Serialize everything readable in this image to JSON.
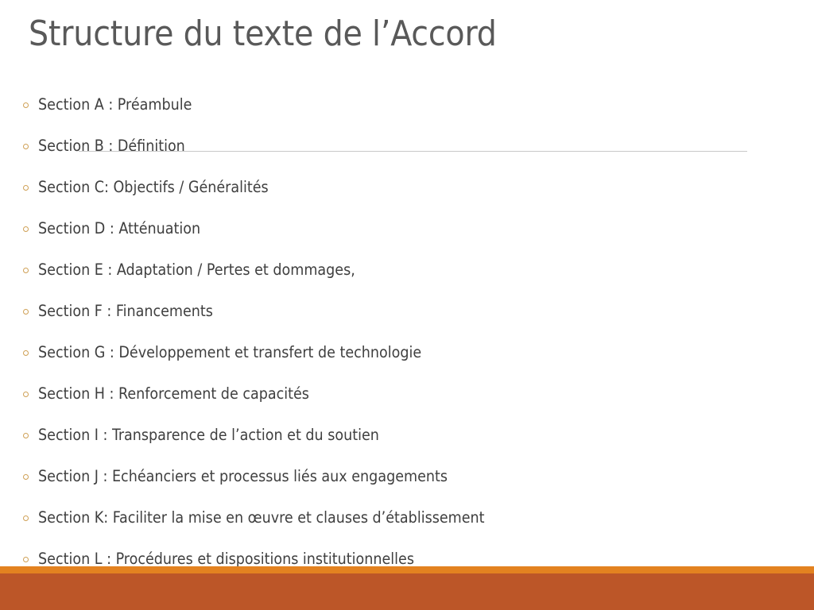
{
  "slide": {
    "title": "Structure du texte de l’Accord",
    "title_color": "#595959",
    "background_color": "#ffffff",
    "bullet_glyph": "◦",
    "bullet_color": "#CFA055",
    "body_text_color": "#3f3f3f",
    "divider_color": "#c9c9c9",
    "items": [
      {
        "label": "Section A : Préambule"
      },
      {
        "label": "Section B : Définition"
      },
      {
        "label": "Section C: Objectifs / Généralités"
      },
      {
        "label": "Section D : Atténuation"
      },
      {
        "label": "Section E : Adaptation / Pertes et dommages,"
      },
      {
        "label": "Section F : Financements"
      },
      {
        "label": "Section G : Développement et transfert de technologie"
      },
      {
        "label": "Section H : Renforcement de capacités"
      },
      {
        "label": "Section I : Transparence de l’action et du soutien"
      },
      {
        "label": "Section J : Echéanciers et processus liés aux engagements"
      },
      {
        "label": "Section K: Faciliter la mise en œuvre et clauses d’établissement"
      },
      {
        "label": "Section L : Procédures et dispositions institutionnelles"
      }
    ],
    "footer": {
      "accent_strip_color": "#E38220",
      "band_color": "#BC5628"
    }
  }
}
